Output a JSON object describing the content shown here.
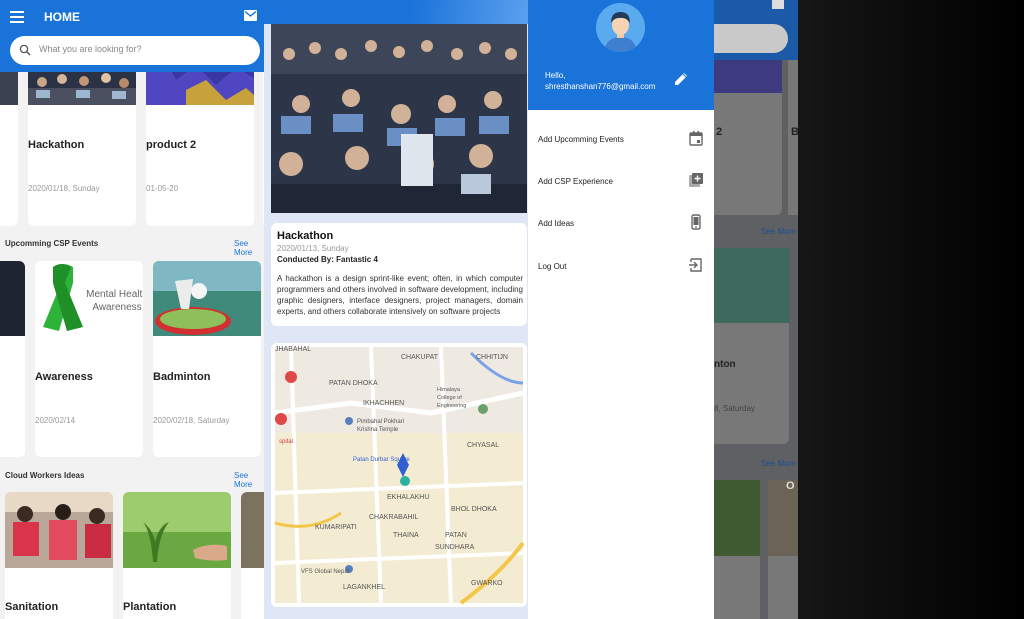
{
  "home": {
    "title": "HOME",
    "search_placeholder": "What you are looking for?",
    "top_cards": [
      {
        "name": "Hackathon",
        "date": "2020/01/18, Sunday"
      },
      {
        "name": "product 2",
        "date": "01-05-20"
      }
    ],
    "events_section": {
      "title": "Upcomming CSP Events",
      "see_more": "See More"
    },
    "event_cards": [
      {
        "name": "Awareness",
        "date": "2020/02/14",
        "image_text_line1": "Mental Health",
        "image_text_line2": "Awareness"
      },
      {
        "name": "Badminton",
        "date": "2020/02/18, Saturday"
      }
    ],
    "ideas_section": {
      "title": "Cloud Workers Ideas",
      "see_more": "See More"
    },
    "idea_cards": [
      {
        "name": "Sanitation"
      },
      {
        "name": "Plantation"
      }
    ]
  },
  "detail": {
    "title": "Hackathon",
    "date": "2020/01/13, Sunday",
    "conducted_by": "Conducted By: Fantastic 4",
    "description": "A hackathon is a design sprint-like event; often, in which computer programmers and others involved in software development, including graphic designers, interface designers, project managers, domain experts, and others collaborate intensively on software projects",
    "map_labels": {
      "chakupat": "CHAKUPAT",
      "chhitijn": "CHHITIJN",
      "patan_dhoka": "PATAN DHOKA",
      "ikhachhen": "IKHACHHEN",
      "himalaya_1": "Himalaya",
      "himalaya_2": "College of",
      "himalaya_3": "Engineering",
      "pimbahal_1": "Pimbahal Pokhari",
      "pimbahal_2": "Krishna Temple",
      "chyasal": "CHYASAL",
      "patan_durbar": "Patan Durbar Square",
      "ekhalakhu": "EKHALAKHU",
      "bhol_dhoka": "BHOL DHOKA",
      "chakrabahil": "CHAKRABAHIL",
      "kumaripati": "KUMARIPATI",
      "thaina": "THAINA",
      "patan": "PATAN",
      "sundhara": "SUNDHARA",
      "vfs_1": "VFS Global Nepal",
      "gwarko": "GWARKO",
      "lagankhel": "LAGANKHEL",
      "jhabahal": "JHABAHAL",
      "hospital": "spital"
    }
  },
  "drawer": {
    "greeting": "Hello,",
    "email": "shresthanshan776@gmail.com",
    "items": [
      {
        "label": "Add Upcomming Events",
        "icon": "calendar-icon"
      },
      {
        "label": "Add CSP Experience",
        "icon": "add-box-icon"
      },
      {
        "label": "Add Ideas",
        "icon": "phone-icon"
      },
      {
        "label": "Log Out",
        "icon": "logout-icon"
      }
    ]
  },
  "underlay": {
    "card_fragment_1": "2",
    "card_fragment_2": "B",
    "see_more_1": "See More",
    "name_fragment": "nton",
    "date_fragment": "8, Saturday",
    "see_more_2": "See More",
    "letter_fragment": "O"
  },
  "colors": {
    "primary": "#1a73d9",
    "background": "#f2f2f2"
  }
}
